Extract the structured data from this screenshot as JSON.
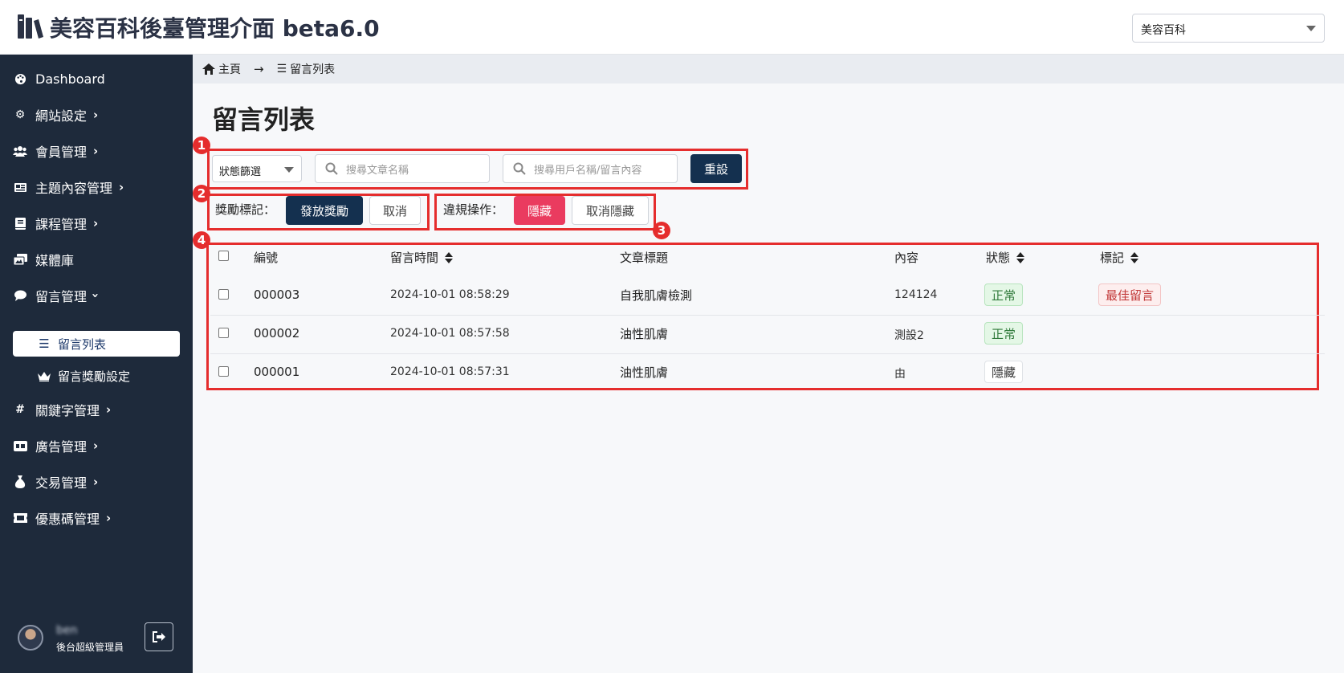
{
  "header": {
    "title": "美容百科後臺管理介面 beta6.0",
    "site_select": "美容百科"
  },
  "sidebar": {
    "items": [
      {
        "label": "Dashboard",
        "icon": "palette-icon"
      },
      {
        "label": "網站設定",
        "icon": "gear-icon"
      },
      {
        "label": "會員管理",
        "icon": "users-icon"
      },
      {
        "label": "主題內容管理",
        "icon": "newspaper-icon"
      },
      {
        "label": "課程管理",
        "icon": "book-icon"
      },
      {
        "label": "媒體庫",
        "icon": "images-icon"
      },
      {
        "label": "留言管理",
        "icon": "comment-icon"
      },
      {
        "label": "關鍵字管理",
        "icon": "hashtag-icon"
      },
      {
        "label": "廣告管理",
        "icon": "ad-icon"
      },
      {
        "label": "交易管理",
        "icon": "money-bag-icon"
      },
      {
        "label": "優惠碼管理",
        "icon": "ticket-icon"
      }
    ],
    "sub_items": [
      {
        "label": "留言列表",
        "icon": "list-icon",
        "active": true
      },
      {
        "label": "留言獎勵設定",
        "icon": "crown-icon",
        "active": false
      }
    ],
    "user": {
      "name": "ben",
      "role": "後台超級管理員"
    }
  },
  "breadcrumb": {
    "home": "主頁",
    "current": "留言列表"
  },
  "page": {
    "title": "留言列表"
  },
  "filters": {
    "status_select": "狀態篩選",
    "article_search_placeholder": "搜尋文章名稱",
    "user_search_placeholder": "搜尋用戶名稱/留言內容",
    "reset_label": "重設"
  },
  "reward": {
    "label": "獎勵標記：",
    "give_label": "發放獎勵",
    "cancel_label": "取消"
  },
  "violation": {
    "label": "違規操作：",
    "hide_label": "隱藏",
    "unhide_label": "取消隱藏"
  },
  "annotations": [
    "1",
    "2",
    "3",
    "4"
  ],
  "table": {
    "headers": {
      "id": "編號",
      "time": "留言時間",
      "article": "文章標題",
      "content": "內容",
      "status": "狀態",
      "mark": "標記"
    },
    "rows": [
      {
        "id": "000003",
        "time": "2024-10-01 08:58:29",
        "article": "自我肌膚檢測",
        "content": "124124",
        "status": "正常",
        "mark": "最佳留言"
      },
      {
        "id": "000002",
        "time": "2024-10-01 08:57:58",
        "article": "油性肌膚",
        "content": "測設2",
        "status": "正常",
        "mark": ""
      },
      {
        "id": "000001",
        "time": "2024-10-01 08:57:31",
        "article": "油性肌膚",
        "content": "由",
        "status": "隱藏",
        "mark": ""
      }
    ]
  },
  "colors": {
    "sidebar_bg": "#1e2a3b",
    "primary_dark": "#14304f",
    "danger": "#ea3b5f",
    "annotation": "#e52d2d"
  }
}
